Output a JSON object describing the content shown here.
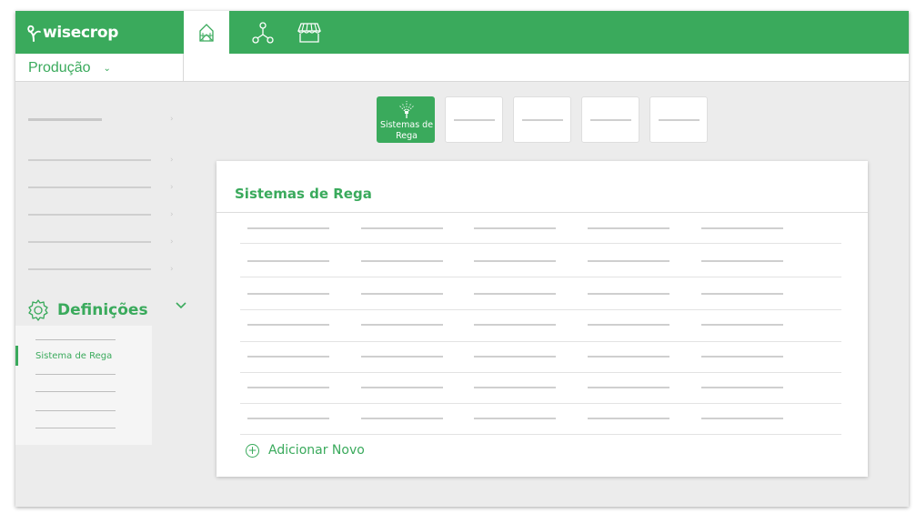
{
  "app": {
    "logo_text": "wisecrop",
    "brand_color": "#3aaa5c"
  },
  "topnav": {
    "tabs": [
      {
        "icon": "greenhouse-icon",
        "active": true
      },
      {
        "icon": "network-icon",
        "active": false
      },
      {
        "icon": "market-stall-icon",
        "active": false
      }
    ]
  },
  "subbar": {
    "selected": "Produção"
  },
  "sidebar": {
    "section_title": "Definições",
    "active_item": "Sistema de Rega"
  },
  "tiles": [
    {
      "label": "Sistemas de Rega",
      "active": true,
      "icon": "sprinkler-icon"
    },
    {
      "label": "",
      "active": false
    },
    {
      "label": "",
      "active": false
    },
    {
      "label": "",
      "active": false
    },
    {
      "label": "",
      "active": false
    }
  ],
  "card": {
    "title": "Sistemas de Rega",
    "add_new_label": "Adicionar Novo"
  }
}
